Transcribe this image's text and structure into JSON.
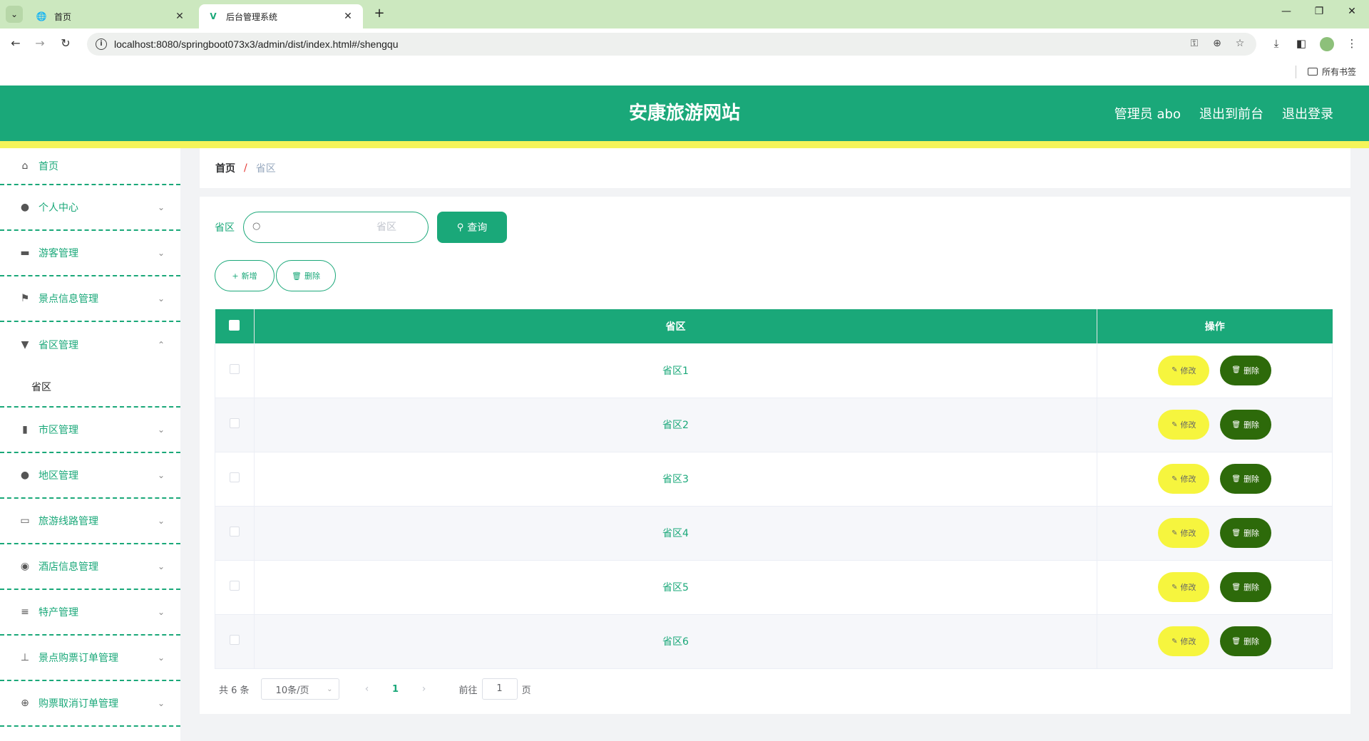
{
  "browser": {
    "tabs": [
      {
        "title": "首页",
        "active": false
      },
      {
        "title": "后台管理系统",
        "active": true
      }
    ],
    "url": "localhost:8080/springboot073x3/admin/dist/index.html#/shengqu",
    "bookmark_folder": "所有书签"
  },
  "header": {
    "title": "安康旅游网站",
    "links": [
      "管理员 abo",
      "退出到前台",
      "退出登录"
    ],
    "colors": {
      "primary": "#1aa879",
      "stripe": "#f4f45a"
    }
  },
  "sidebar": {
    "items": [
      {
        "label": "首页",
        "icon": "home-icon"
      },
      {
        "label": "个人中心",
        "icon": "user-icon"
      },
      {
        "label": "游客管理",
        "icon": "ticket-icon"
      },
      {
        "label": "景点信息管理",
        "icon": "flag-icon"
      },
      {
        "label": "省区管理",
        "icon": "brush-icon",
        "expanded": true,
        "children": [
          "省区"
        ]
      },
      {
        "label": "市区管理",
        "icon": "bar-chart-icon"
      },
      {
        "label": "地区管理",
        "icon": "user-icon"
      },
      {
        "label": "旅游线路管理",
        "icon": "message-icon"
      },
      {
        "label": "酒店信息管理",
        "icon": "balloon-icon"
      },
      {
        "label": "特产管理",
        "icon": "sliders-icon"
      },
      {
        "label": "景点购票订单管理",
        "icon": "stamp-icon"
      },
      {
        "label": "购票取消订单管理",
        "icon": "compass-icon"
      }
    ]
  },
  "breadcrumb": {
    "home": "首页",
    "separator": "/",
    "current": "省区"
  },
  "search": {
    "label": "省区",
    "placeholder": "省区",
    "value": "",
    "button": "查询"
  },
  "actions": {
    "add": "新增",
    "delete": "删除"
  },
  "table": {
    "columns": [
      "省区",
      "操作"
    ],
    "rows": [
      "省区1",
      "省区2",
      "省区3",
      "省区4",
      "省区5",
      "省区6"
    ],
    "edit_label": "修改",
    "delete_label": "删除"
  },
  "pagination": {
    "total": "共 6 条",
    "page_size": "10条/页",
    "current_page": "1",
    "goto_prefix": "前往",
    "goto_value": "1",
    "goto_suffix": "页"
  }
}
